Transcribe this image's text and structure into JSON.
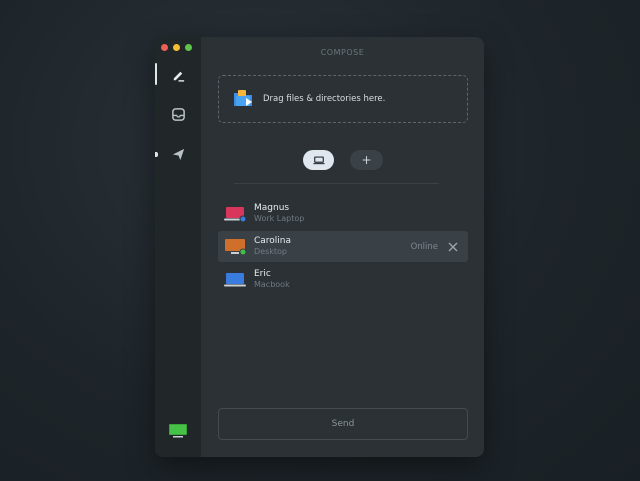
{
  "window": {
    "title": "COMPOSE"
  },
  "sidebar": {
    "items": [
      {
        "name": "compose",
        "icon": "pencil-icon"
      },
      {
        "name": "inbox",
        "icon": "inbox-tray-icon"
      },
      {
        "name": "sent",
        "icon": "paper-plane-icon"
      }
    ],
    "device_icon": "monitor-icon"
  },
  "dropzone": {
    "label": "Drag files & directories here."
  },
  "device_tabs": [
    {
      "icon": "laptop-icon",
      "selected": true
    },
    {
      "icon": "plus-icon",
      "label": "+"
    }
  ],
  "devices": [
    {
      "name": "Magnus",
      "type": "Work Laptop",
      "color": "#d8365a",
      "status_dot": "#3a7be0",
      "icon": "laptop-icon"
    },
    {
      "name": "Carolina",
      "type": "Desktop",
      "color": "#cf6f2b",
      "status_dot": "#3ec24a",
      "icon": "monitor-icon",
      "status": "Online",
      "selected": true
    },
    {
      "name": "Eric",
      "type": "Macbook",
      "color": "#3a7be0",
      "icon": "laptop-icon"
    }
  ],
  "actions": {
    "send_label": "Send"
  },
  "colors": {
    "accent": "#dfe8ee",
    "online": "#3ec24a"
  }
}
